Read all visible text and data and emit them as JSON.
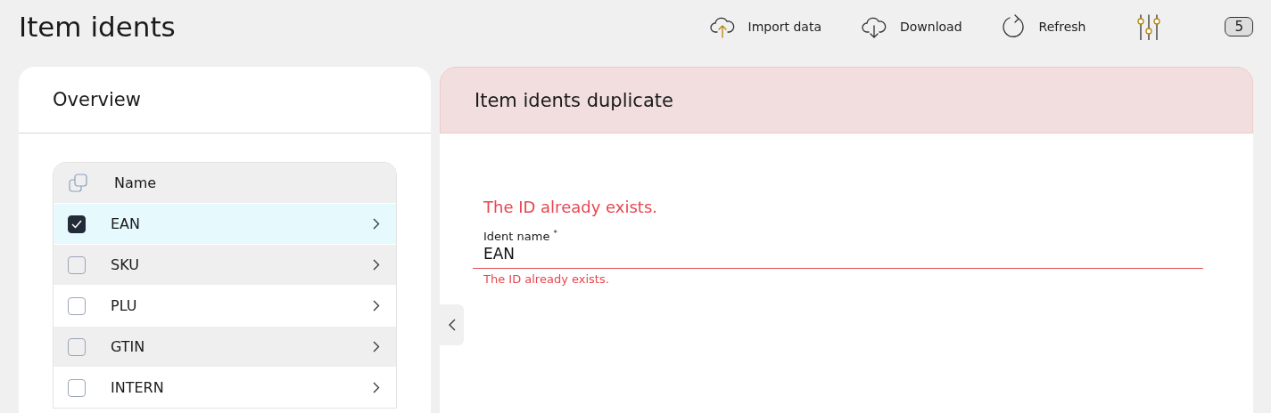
{
  "page": {
    "title": "Item idents"
  },
  "toolbar": [
    {
      "kind": "upload",
      "label": "Import data"
    },
    {
      "kind": "download",
      "label": "Download"
    },
    {
      "kind": "refresh",
      "label": "Refresh"
    },
    {
      "kind": "filters"
    }
  ],
  "count_badge": "5",
  "overview": {
    "title": "Overview",
    "column": "Name",
    "rows": [
      {
        "name": "EAN",
        "checked": true,
        "selected": true
      },
      {
        "name": "SKU",
        "checked": false,
        "selected": false
      },
      {
        "name": "PLU",
        "checked": false,
        "selected": false
      },
      {
        "name": "GTIN",
        "checked": false,
        "selected": false
      },
      {
        "name": "INTERN",
        "checked": false,
        "selected": false
      }
    ]
  },
  "detail": {
    "title": "Item idents duplicate",
    "error": "The ID already exists.",
    "field": {
      "label": "Ident name",
      "required_mark": "*",
      "value": "EAN",
      "error": "The ID already exists."
    }
  }
}
